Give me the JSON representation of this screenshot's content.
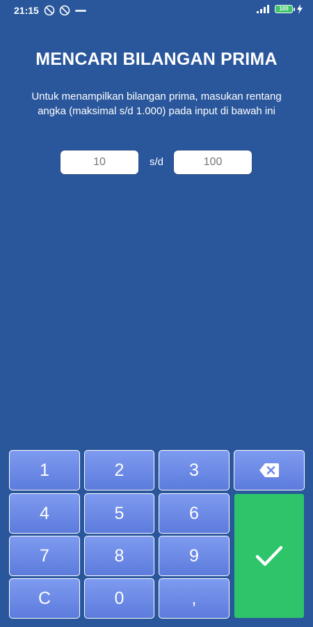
{
  "status_bar": {
    "time": "21:15",
    "battery_level": "100",
    "icons": [
      "notification-blocked-icon",
      "notification-blocked-icon",
      "network-speed-icon",
      "signal-icon",
      "battery-icon",
      "charging-icon"
    ]
  },
  "header": {
    "title": "MENCARI BILANGAN PRIMA"
  },
  "instruction": {
    "text": "Untuk menampilkan bilangan prima, masukan rentang angka (maksimal  s/d 1.000) pada input di bawah ini"
  },
  "range": {
    "from_value": "10",
    "separator": "s/d",
    "to_value": "100"
  },
  "keypad": {
    "keys": [
      "1",
      "2",
      "3",
      "4",
      "5",
      "6",
      "7",
      "8",
      "9",
      "C",
      "0",
      ","
    ],
    "backspace_icon": "backspace-icon",
    "submit_icon": "check-icon"
  },
  "colors": {
    "background": "#2A579B",
    "key": "#6E8BE8",
    "submit": "#2DC46A"
  }
}
